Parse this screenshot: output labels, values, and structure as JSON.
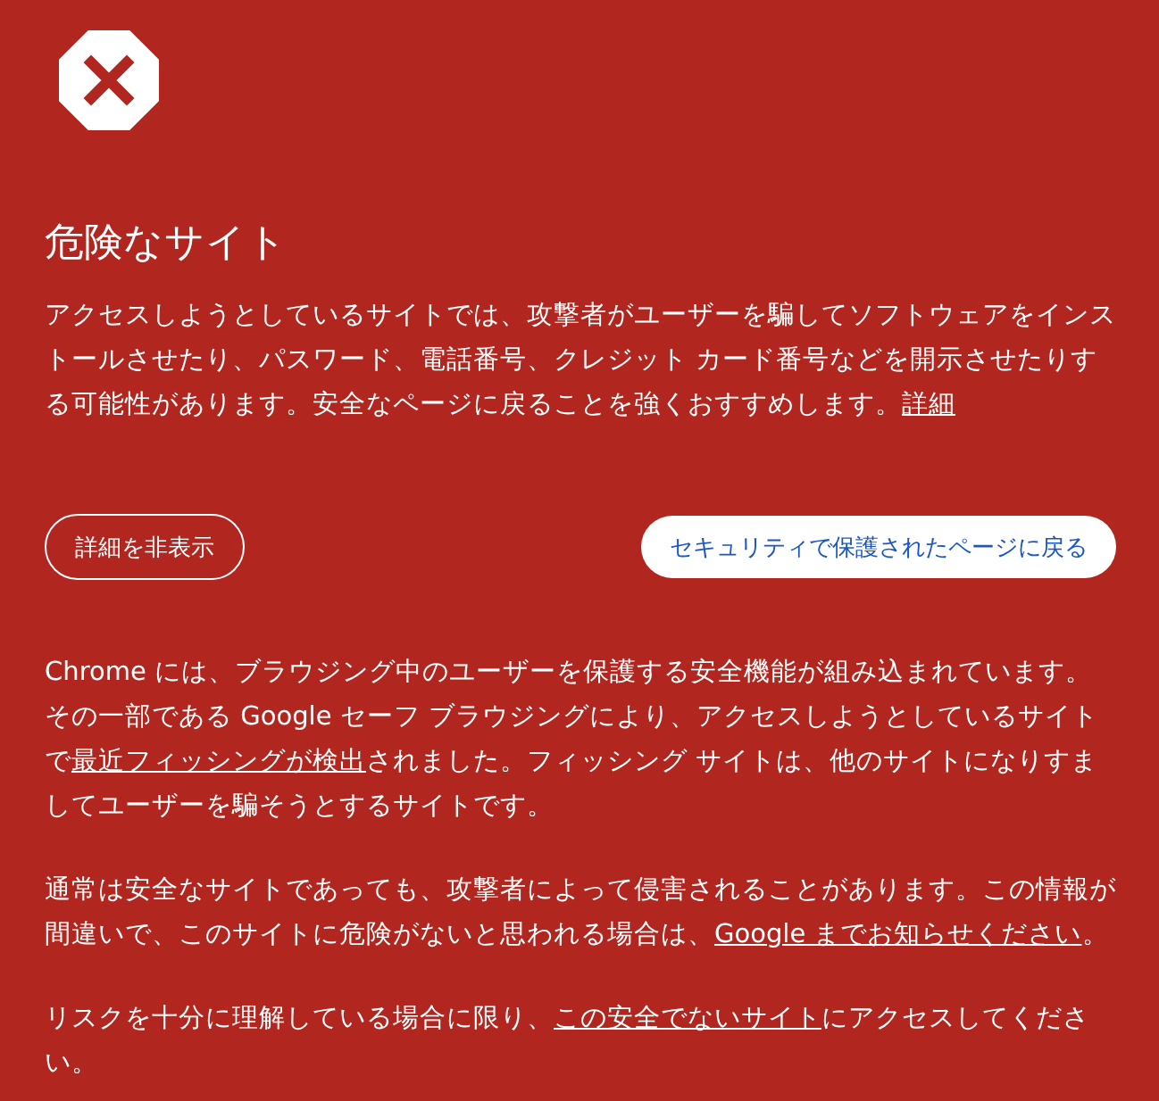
{
  "title": "危険なサイト",
  "intro": [
    {
      "kind": "text",
      "text": "アクセスしようとしているサイトでは、攻撃者がユーザーを騙してソフトウェアをインストールさせたり、パスワード、電話番号、クレジット カード番号などを開示させたりする可能性があります。安全なページに戻ることを強くおすすめします。"
    },
    {
      "kind": "link",
      "text": "詳細"
    }
  ],
  "buttons": [
    {
      "label": "詳細を非表示",
      "kind": "outline"
    },
    {
      "label": "セキュリティで保護されたページに戻る",
      "kind": "primary"
    }
  ],
  "details": [
    [
      {
        "kind": "text",
        "text": "Chrome には、ブラウジング中のユーザーを保護する安全機能が組み込まれています。その一部である Google セーフ ブラウジングにより、アクセスしようとしているサイトで"
      },
      {
        "kind": "link",
        "text": "最近フィッシングが検出"
      },
      {
        "kind": "text",
        "text": "されました。フィッシング サイトは、他のサイトになりすましてユーザーを騙そうとするサイトです。"
      }
    ],
    [
      {
        "kind": "text",
        "text": "通常は安全なサイトであっても、攻撃者によって侵害されることがあります。この情報が間違いで、このサイトに危険がないと思われる場合は、"
      },
      {
        "kind": "link",
        "text": "Google までお知らせください"
      },
      {
        "kind": "text",
        "text": "。"
      }
    ],
    [
      {
        "kind": "text",
        "text": "リスクを十分に理解している場合に限り、"
      },
      {
        "kind": "link",
        "text": "この安全でないサイト"
      },
      {
        "kind": "text",
        "text": "にアクセスしてください。"
      }
    ]
  ]
}
